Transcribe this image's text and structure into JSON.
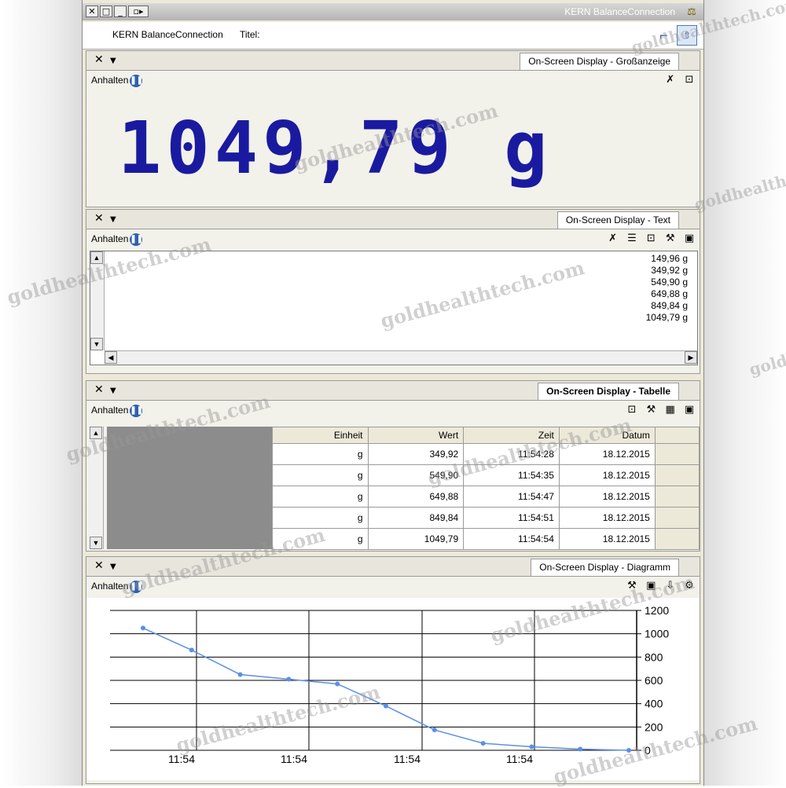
{
  "window": {
    "title": "KERN BalanceConnection",
    "titel_label": "Titel:",
    "titel_value": "KERN BalanceConnection"
  },
  "panels": {
    "big": {
      "tab": "On-Screen Display - Großanzeige",
      "pause_label": "Anhalten",
      "value": "1049,79 g"
    },
    "text": {
      "tab": "On-Screen Display - Text",
      "pause_label": "Anhalten",
      "lines": [
        "149,96 g",
        "349,92 g",
        "549,90 g",
        "649,88 g",
        "849,84 g",
        "1049,79 g"
      ]
    },
    "table": {
      "tab": "On-Screen Display - Tabelle",
      "pause_label": "Anhalten",
      "headers": [
        "Datum",
        "Zeit",
        "Wert",
        "Einheit"
      ],
      "rows": [
        [
          "18.12.2015",
          "11:54:28",
          "349,92",
          "g"
        ],
        [
          "18.12.2015",
          "11:54:35",
          "549,90",
          "g"
        ],
        [
          "18.12.2015",
          "11:54:47",
          "649,88",
          "g"
        ],
        [
          "18.12.2015",
          "11:54:51",
          "849,84",
          "g"
        ],
        [
          "18.12.2015",
          "11:54:54",
          "1049,79",
          "g"
        ]
      ]
    },
    "chart": {
      "tab": "On-Screen Display - Diagramm",
      "pause_label": "Anhalten"
    }
  },
  "chart_data": {
    "type": "line",
    "title": "",
    "xlabel": "",
    "ylabel": "",
    "ylim": [
      0,
      1200
    ],
    "yticks": [
      "0",
      "200",
      "400",
      "600",
      "800",
      "1000",
      "1200"
    ],
    "xticks": [
      "11:54",
      "11:54",
      "11:54",
      "11:54"
    ],
    "grid": true,
    "series": [
      {
        "values": [
          0,
          10,
          30,
          60,
          175,
          380,
          570,
          610,
          650,
          860,
          1049
        ],
        "color": "#5b8fe8"
      }
    ]
  },
  "watermark": "goldhealthtech.com",
  "icons": {
    "pause": "pause-icon",
    "save": "save-icon",
    "clear": "clear-icon",
    "settings": "settings-icon",
    "close": "close-icon",
    "dropdown": "dropdown-icon"
  }
}
